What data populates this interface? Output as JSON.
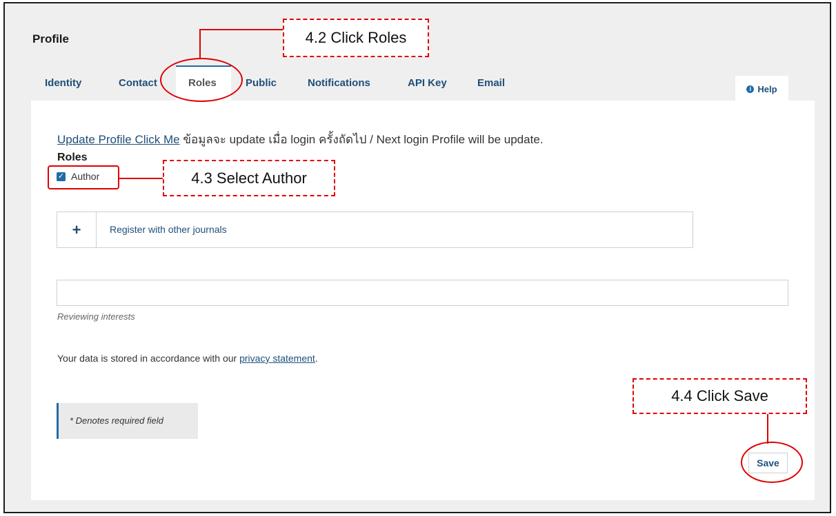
{
  "page": {
    "title": "Profile"
  },
  "tabs": [
    {
      "label": "Identity"
    },
    {
      "label": "Contact"
    },
    {
      "label": "Roles",
      "active": true
    },
    {
      "label": "Public"
    },
    {
      "label": "Notifications"
    },
    {
      "label": "API Key"
    },
    {
      "label": "Email"
    }
  ],
  "help": {
    "label": "Help",
    "icon": "info-circle-icon"
  },
  "notice": {
    "link_text": "Update Profile Click Me",
    "text": "ข้อมูลจะ update เมื่อ login ครั้งถัดไป / Next login Profile will be update."
  },
  "roles": {
    "heading": "Roles",
    "author_label": "Author",
    "author_checked": true
  },
  "accordion": {
    "icon": "plus-icon",
    "label": "Register with other journals"
  },
  "reviewing": {
    "value": "",
    "label": "Reviewing interests"
  },
  "privacy": {
    "prefix": "Your data is stored in accordance with our ",
    "link_text": "privacy statement",
    "suffix": "."
  },
  "required_note": "* Denotes required field",
  "save_label": "Save",
  "annotations": {
    "click_roles": "4.2 Click Roles",
    "select_author": "4.3 Select Author",
    "click_save": "4.4 Click Save",
    "color": "#e00000"
  },
  "colors": {
    "accent": "#1e6ba8",
    "link": "#1e4f7a",
    "background": "#efefef"
  }
}
